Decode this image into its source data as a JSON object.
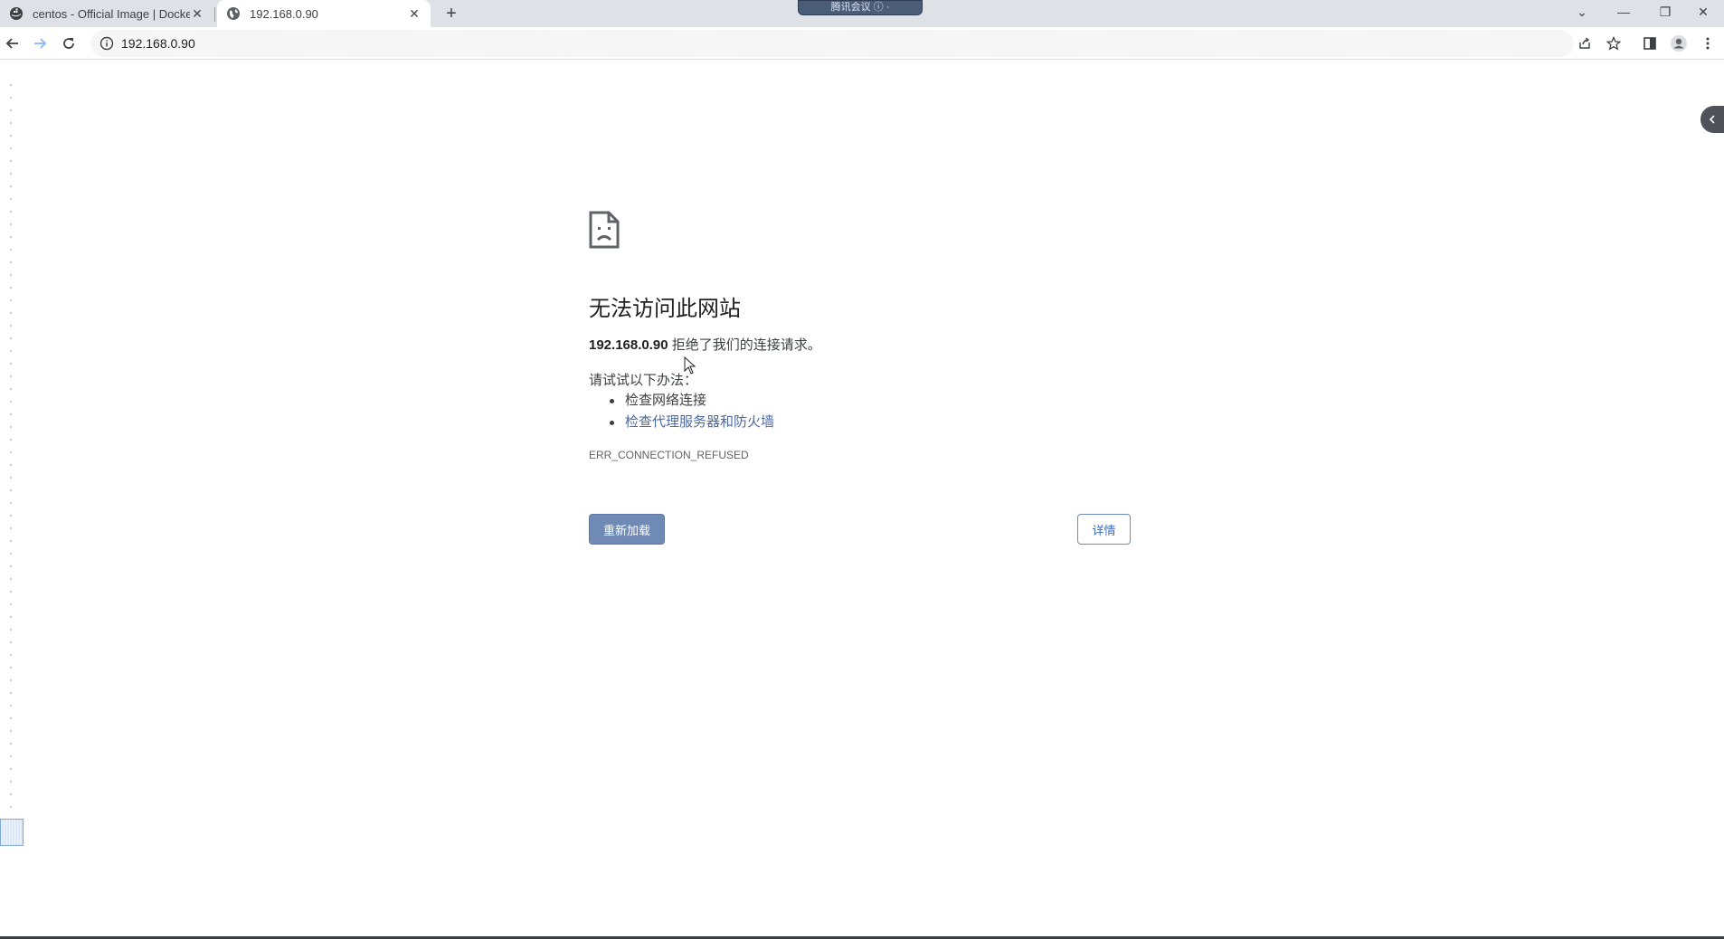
{
  "tabs": [
    {
      "title": "centos - Official Image | Docker",
      "icon": "docker-whale-icon",
      "active": false
    },
    {
      "title": "192.168.0.90",
      "icon": "globe-icon",
      "active": true
    }
  ],
  "meeting_badge": "腾讯会议 ⓘ ·",
  "address_bar": {
    "url": "192.168.0.90",
    "icon": "info-icon"
  },
  "error_page": {
    "title": "无法访问此网站",
    "host": "192.168.0.90",
    "message": "拒绝了我们的连接请求。",
    "try_label": "请试试以下办法：",
    "suggestions": [
      "检查网络连接",
      "检查代理服务器和防火墙"
    ],
    "error_code": "ERR_CONNECTION_REFUSED",
    "reload_button": "重新加载",
    "details_button": "详情"
  },
  "colors": {
    "primary_button": "#6f8bb5",
    "link": "#4c69a1",
    "tab_strip": "#dee1e6"
  }
}
